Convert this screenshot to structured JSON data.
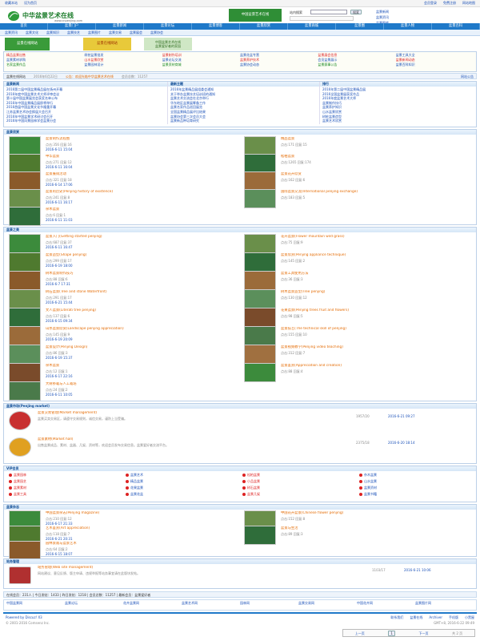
{
  "topbar": {
    "left": [
      "收藏本站",
      "设为首页"
    ],
    "right": [
      "会员登录",
      "免费注册",
      "网站地图"
    ]
  },
  "logo": {
    "text": "中华盆景艺术在线",
    "domain": "www.cnpenjing.com"
  },
  "header": {
    "search_label": "站内搜索",
    "search_button": "搜索",
    "right_links": [
      "盆景新闻",
      "盆景资讯",
      "盆景图库"
    ]
  },
  "nav": [
    "首页",
    "盆景门户",
    "盆景新闻",
    "盆景论坛",
    "盆景博客",
    "盆景欣赏",
    "盆景商城",
    "盆景圈",
    "盆景人物",
    "盆景百科"
  ],
  "subnav": [
    "盆景资讯",
    "盆景文化",
    "盆景知识",
    "盆景技艺",
    "盆景图片",
    "盆景交易",
    "盆景展会",
    "盆景协会"
  ],
  "banner": {
    "left": "盆景在线网站",
    "middle": "盆景在线网站",
    "right_title": "中国盆景艺术在线",
    "right_sub": "盆景爱好者的家园"
  },
  "ads": {
    "row1": [
      "精品盆景出售",
      "树桩盆景批发",
      "盆景制作培训",
      "盆景花盆专营",
      "盆景展会信息",
      "盆景工具大全"
    ],
    "row2": [
      "盆景素材求购",
      "山水盆景欣赏",
      "盆景论坛交流",
      "盆景养护技术",
      "会员盆景展示",
      "盆景新闻动态"
    ],
    "row3": [
      "名家盆景作品",
      "盆景园林设计",
      "盆景资材商城",
      "盆景协会动态",
      "盆景赛事公告",
      "盆景百科知识"
    ]
  },
  "status": {
    "left": "盆景在线网站",
    "announce": "公告：欢迎光临中华盆景艺术在线",
    "count": "会员总数：11257",
    "date": "2016年6月22日",
    "right": "网站公告"
  },
  "news": {
    "hot_title": "盆景新闻",
    "latest_title": "最新主题",
    "rank_title": "排行",
    "hot": [
      "2016第二届中国盆景精品展在扬州开幕",
      "2016年度中国盆景艺术大师评审会议",
      "第十届中国盆景展览会获奖名单公布",
      "2016年中国盆景精品展即将举行",
      "2016首届中国盆景文化节隆重开幕",
      "江苏盆景艺术协会换届大会召开",
      "2016年中国盆景学术研讨会召开",
      "2016年中国风景园林学会盆景分会"
    ],
    "latest": [
      "2016年盆景精品展组委会通知",
      "关于举办盆景技艺培训班的通知",
      "盆景艺术交流会在北京举行",
      "华东地区盆景展筹备工作",
      "盆景名家作品巡回展览",
      "全国盆景精品展评比结果",
      "盆景协会第三次会员大会",
      "盆景新品种培育研究"
    ],
    "rank": [
      "2016年第二届中国盆景精品展",
      "2016全国盆景展获奖作品",
      "2016年度盆景艺术大师",
      "盆景制作技巧",
      "盆景养护知识",
      "山水盆景欣赏",
      "树桩盆景造型",
      "盆景艺术欣赏"
    ]
  },
  "gallery_title": "盆景欣赏",
  "gallery": [
    {
      "title": "盆景制作流程图",
      "meta": "点击:356 回复:16",
      "date": "2016-6-11 15:04",
      "side_title": "精品盆景",
      "side_meta": "点击:171 回复:15"
    },
    {
      "title": "中华盆景",
      "meta": "点击:271 回复:12",
      "date": "2016-6-11 16:04",
      "side_title": "松柏盆景",
      "side_meta": "点击:1265 回复:174"
    },
    {
      "title": "盆景展销活动",
      "meta": "点击:321 回复:18",
      "date": "2016-6-14 17:06",
      "side_title": "盆景花卉欣赏",
      "side_meta": "点击:162 回复:6"
    },
    {
      "title": "盆景的历史(Penjing history of existence)",
      "meta": "点击:241 回复:8",
      "date": "2016-6-11 16:17",
      "side_title": "国际盆景交流(International penjing exchange)",
      "side_meta": "点击:183 回复:5"
    },
    {
      "title": "杂木盆景",
      "meta": "点击:6 回复:1",
      "date": "2016-6-11 11:03",
      "side_title": "",
      "side_meta": ""
    }
  ],
  "styles_title": "盆景之美",
  "styles": [
    {
      "title": "盆景入门(Getting started penjing)",
      "meta": "点击:687 回复:37",
      "date": "2016-6-11 16:47",
      "side_title": "花卉盆景(Flower mountain wild grass)",
      "side_meta": "点击:75 回复:9"
    },
    {
      "title": "盆景造型(Shape penjing)",
      "meta": "点击:299 回复:17",
      "date": "2016-6-19 18:00",
      "side_title": "盆景欣赏(Penjing appliance technique)",
      "side_meta": "点击:145 回复:2"
    },
    {
      "title": "树木盆景制作技巧",
      "meta": "点击:88 回复:6",
      "date": "2016-6-7 17:31",
      "side_title": "盆景工具使用方法",
      "side_meta": "点击:36 回复:3"
    },
    {
      "title": "树石盆景(Tree and stone Waterfront)",
      "meta": "点击:291 回复:17",
      "date": "2016-6-21 15:44",
      "side_title": "树木盆景造型(Tree penjing)",
      "side_meta": "点击:130 回复:12"
    },
    {
      "title": "文人盆景(Literati tree penjing)",
      "meta": "点击:137 回复:6",
      "date": "2016-6-15 09:34",
      "side_title": "花果盆景(Penjing trees fruit and flowers)",
      "side_meta": "点击:98 回复:5"
    },
    {
      "title": "山水盆景欣赏(Landscape penjing appreciation)",
      "meta": "点击:145 回复:9",
      "date": "2016-6-19 20:09",
      "side_title": "盆景技艺(The technical skill of penjing)",
      "side_meta": "点击:155 回复:10"
    },
    {
      "title": "盆景设计(Penjing Design)",
      "meta": "点击:86 回复:3",
      "date": "2016-6-19 15:37",
      "side_title": "盆景视频教学(Penjing video teaching)",
      "side_meta": "点击:312 回复:7"
    },
    {
      "title": "杂木盆景",
      "meta": "点击:12 回复:1",
      "date": "2016-6-17 22:16",
      "side_title": "盆景鉴赏(Appreciation and creation)",
      "side_meta": "点击:88 回复:4"
    },
    {
      "title": "大树移栽与人工栽培",
      "meta": "点击:24 回复:2",
      "date": "2016-6-11 10:05",
      "side_title": "",
      "side_meta": ""
    }
  ],
  "market_title": "盆景市场(Penjing market)",
  "market": [
    {
      "title": "盆景交易管理(Market management)",
      "desc": "盆景买卖交易区，请遵守交易规则，诚信交易，谨防上当受骗。",
      "stats": "1957/20",
      "date": "2016-6-21 09:27"
    },
    {
      "title": "盆景素材(Market hall)",
      "desc": "出售盆景成品、素材、盆器、几架、资材等，欢迎会员发布交易信息。盆景爱好者交流平台。",
      "stats": "2375/18",
      "date": "2016-6-20 18:14"
    }
  ],
  "vip_title": "VIP会员",
  "vip": [
    [
      "盆景园林",
      "盆景艺术",
      "松柏盆景",
      "杂木盆景"
    ],
    [
      "盆景园艺",
      "精品盆景",
      "小品盆景",
      "山水盆景"
    ],
    [
      "盆景素材",
      "花果盆景",
      "树石盆景",
      "盆景资材"
    ],
    [
      "盆景工具",
      "盆景花盆",
      "盆景几架",
      "盆景书籍"
    ]
  ],
  "magazine_title": "盆景杂志",
  "magazine": [
    {
      "title": "中国盆景杂志(Penjing magazine)",
      "meta": "点击:210 回复:12",
      "date": "2016-6-17 21:33",
      "side_title": "中国花卉盆景(Chinese flower penjing)",
      "side_meta": "点击:152 回复:8"
    },
    {
      "title": "艺术鉴赏(Art appreciation)",
      "meta": "点击:118 回复:7",
      "date": "2016-6-21 20:31",
      "side_title": "盆景与生活",
      "side_meta": "点击:89 回复:3"
    },
    {
      "title": "园林景观与盆景艺术",
      "meta": "点击:64 回复:2",
      "date": "2016-6-15 18:07",
      "side_title": "",
      "side_meta": ""
    }
  ],
  "admin_title": "站务管理",
  "admin": {
    "title": "站务管理(Web site management)",
    "desc": "网站建议、意见反馈、版主申请、违规举报等站务事宜请在此版块发帖。",
    "stats": "1103/17",
    "date": "2016-6-21 10:06"
  },
  "stats_bar": "在线会员：231人 | 今日发帖：1433 | 昨日发帖：1218 | 会员总数：11257 | 最新会员：盆景爱好者",
  "links": [
    "中国盆景网",
    "盆景论坛",
    "花卉盆景网",
    "盆景艺术网",
    "园林网",
    "盆景交易网",
    "中国花卉网",
    "盆景图片网"
  ],
  "footer": {
    "left": "Powered by Discuz! X3",
    "copy": "© 2001-2016 Comsenz Inc.",
    "links": [
      "联系我们",
      "盆景在线",
      "Archiver",
      "手机版",
      "小黑屋"
    ],
    "time": "GMT+8, 2016-6-22 09:49"
  },
  "pager": {
    "prev": "上一页",
    "page": "1",
    "next": "下一页",
    "total": "共 2 页"
  }
}
